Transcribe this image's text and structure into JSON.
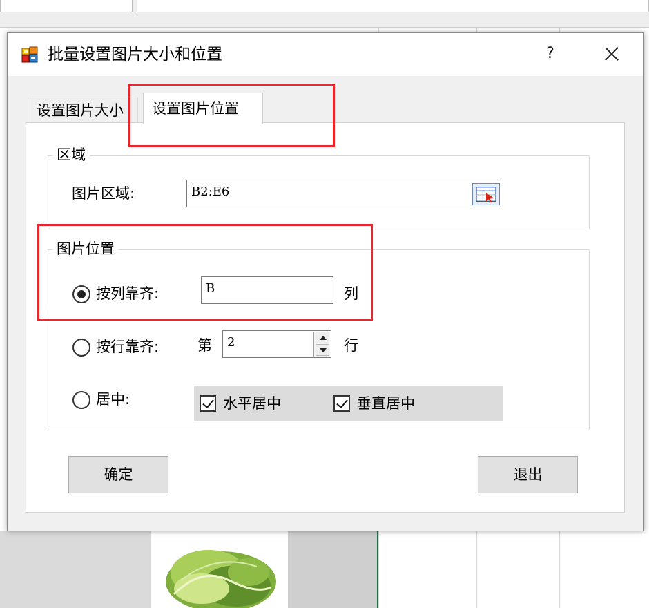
{
  "dialog": {
    "title": "批量设置图片大小和位置",
    "help_label": "?",
    "icon": "app-window-icon",
    "close_icon": "close-icon"
  },
  "tabs": [
    {
      "label": "设置图片大小",
      "active": false
    },
    {
      "label": "设置图片位置",
      "active": true
    }
  ],
  "area_group": {
    "legend": "区域",
    "range_label": "图片区域:",
    "range_value": "B2:E6",
    "range_button_icon": "range-select-icon"
  },
  "position_group": {
    "legend": "图片位置",
    "by_column": {
      "label": "按列靠齐:",
      "value": "B",
      "unit": "列",
      "selected": true
    },
    "by_row": {
      "label": "按行靠齐:",
      "prefix": "第",
      "value": "2",
      "unit": "行",
      "selected": false
    },
    "center": {
      "label": "居中:",
      "selected": false,
      "horizontal": {
        "label": "水平居中",
        "checked": true
      },
      "vertical": {
        "label": "垂直居中",
        "checked": true
      }
    }
  },
  "buttons": {
    "ok_label": "确定",
    "exit_label": "退出"
  },
  "colors": {
    "annotation": "#e8262b",
    "excel_green": "#217346"
  }
}
